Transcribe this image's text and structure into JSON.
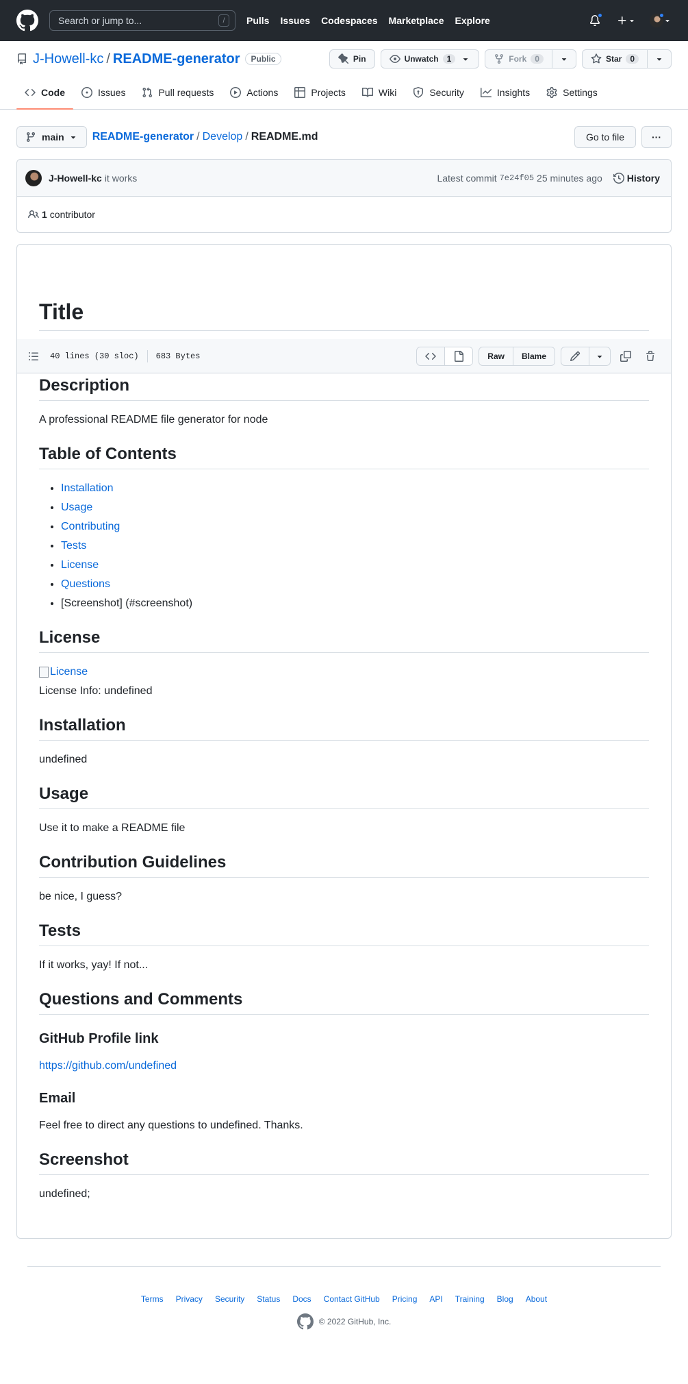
{
  "header": {
    "search_placeholder": "Search or jump to...",
    "slash_key": "/",
    "nav": [
      "Pulls",
      "Issues",
      "Codespaces",
      "Marketplace",
      "Explore"
    ]
  },
  "repo": {
    "owner": "J-Howell-kc",
    "separator": "/",
    "name": "README-generator",
    "visibility": "Public",
    "pin_label": "Pin",
    "unwatch_label": "Unwatch",
    "watch_count": "1",
    "fork_label": "Fork",
    "fork_count": "0",
    "star_label": "Star",
    "star_count": "0"
  },
  "repo_nav": {
    "tabs": [
      {
        "label": "Code",
        "icon": "code-icon"
      },
      {
        "label": "Issues",
        "icon": "issue-icon"
      },
      {
        "label": "Pull requests",
        "icon": "pull-request-icon"
      },
      {
        "label": "Actions",
        "icon": "play-icon"
      },
      {
        "label": "Projects",
        "icon": "table-icon"
      },
      {
        "label": "Wiki",
        "icon": "book-icon"
      },
      {
        "label": "Security",
        "icon": "shield-icon"
      },
      {
        "label": "Insights",
        "icon": "graph-icon"
      },
      {
        "label": "Settings",
        "icon": "gear-icon"
      }
    ]
  },
  "file_nav": {
    "branch": "main",
    "crumb_repo": "README-generator",
    "crumb_sep": "/",
    "crumb_dir": "Develop",
    "crumb_file": "README.md",
    "go_to_file": "Go to file",
    "more": "···"
  },
  "commit": {
    "author": "J-Howell-kc",
    "message": "it works",
    "latest_label": "Latest commit",
    "sha": "7e24f05",
    "time": "25 minutes ago",
    "history_label": "History",
    "contributors_count": "1",
    "contributors_label": "contributor"
  },
  "file_toolbar": {
    "lines": "40 lines (30 sloc)",
    "size": "683 Bytes",
    "raw": "Raw",
    "blame": "Blame"
  },
  "readme": {
    "title": "Title",
    "description_h": "Description",
    "description": "A professional README file generator for node",
    "toc_h": "Table of Contents",
    "toc": [
      "Installation",
      "Usage",
      "Contributing",
      "Tests",
      "License",
      "Questions"
    ],
    "toc_plain": "[Screenshot] (#screenshot)",
    "license_h": "License",
    "license_badge_alt": "License",
    "license_info": "License Info: undefined",
    "installation_h": "Installation",
    "installation": "undefined",
    "usage_h": "Usage",
    "usage": "Use it to make a README file",
    "contribution_h": "Contribution Guidelines",
    "contribution": "be nice, I guess?",
    "tests_h": "Tests",
    "tests": "If it works, yay! If not...",
    "questions_h": "Questions and Comments",
    "profile_h": "GitHub Profile link",
    "profile_link": "https://github.com/undefined",
    "email_h": "Email",
    "email": "Feel free to direct any questions to undefined. Thanks.",
    "screenshot_h": "Screenshot",
    "screenshot": "undefined;"
  },
  "footer": {
    "links": [
      "Terms",
      "Privacy",
      "Security",
      "Status",
      "Docs",
      "Contact GitHub",
      "Pricing",
      "API",
      "Training",
      "Blog",
      "About"
    ],
    "copyright": "© 2022 GitHub, Inc."
  },
  "colors": {
    "header_bg": "#24292f",
    "link": "#0969da",
    "active_tab_underline": "#fd8c73",
    "notification_dot": "#2f81f7"
  }
}
